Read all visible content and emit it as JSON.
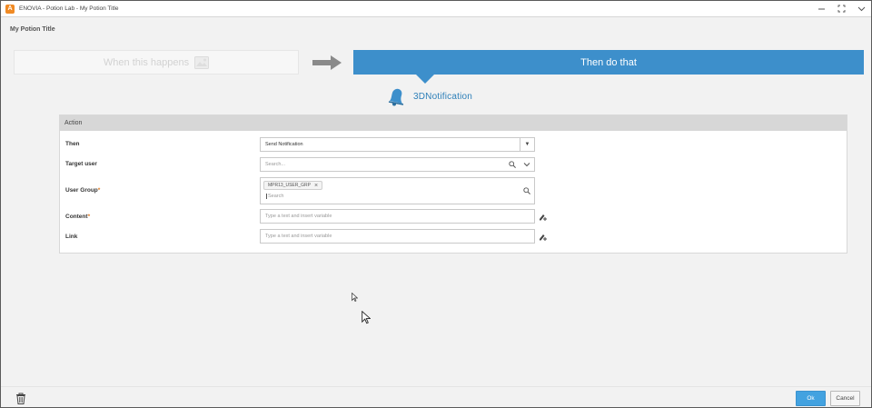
{
  "window": {
    "title": "ENOVIA - Potion Lab - My Potion Title",
    "app_icon": "enovia-app-icon",
    "controls": [
      "minimize-icon",
      "maximize-icon",
      "chevron-down-icon"
    ]
  },
  "page": {
    "potion_title": "My Potion Title"
  },
  "workflow": {
    "when_label": "When this happens",
    "then_label": "Then do that",
    "brand_name": "3DNotification"
  },
  "action": {
    "header": "Action",
    "then": {
      "label": "Then",
      "value": "Send Notification"
    },
    "target_user": {
      "label": "Target user",
      "placeholder": "Search..."
    },
    "user_group": {
      "label": "User Group",
      "required_mark": "*",
      "tag": "MPR13_USER_GRP",
      "placeholder": "Search"
    },
    "content": {
      "label": "Content",
      "required_mark": "*",
      "placeholder": "Type a text and insert variable"
    },
    "link": {
      "label": "Link",
      "placeholder": "Type a text and insert variable"
    }
  },
  "footer": {
    "ok_label": "Ok",
    "cancel_label": "Cancel"
  },
  "colors": {
    "accent": "#3d8fcb",
    "ok_button": "#43a2e0",
    "required": "#e07b22",
    "app_icon": "#f08a24"
  }
}
